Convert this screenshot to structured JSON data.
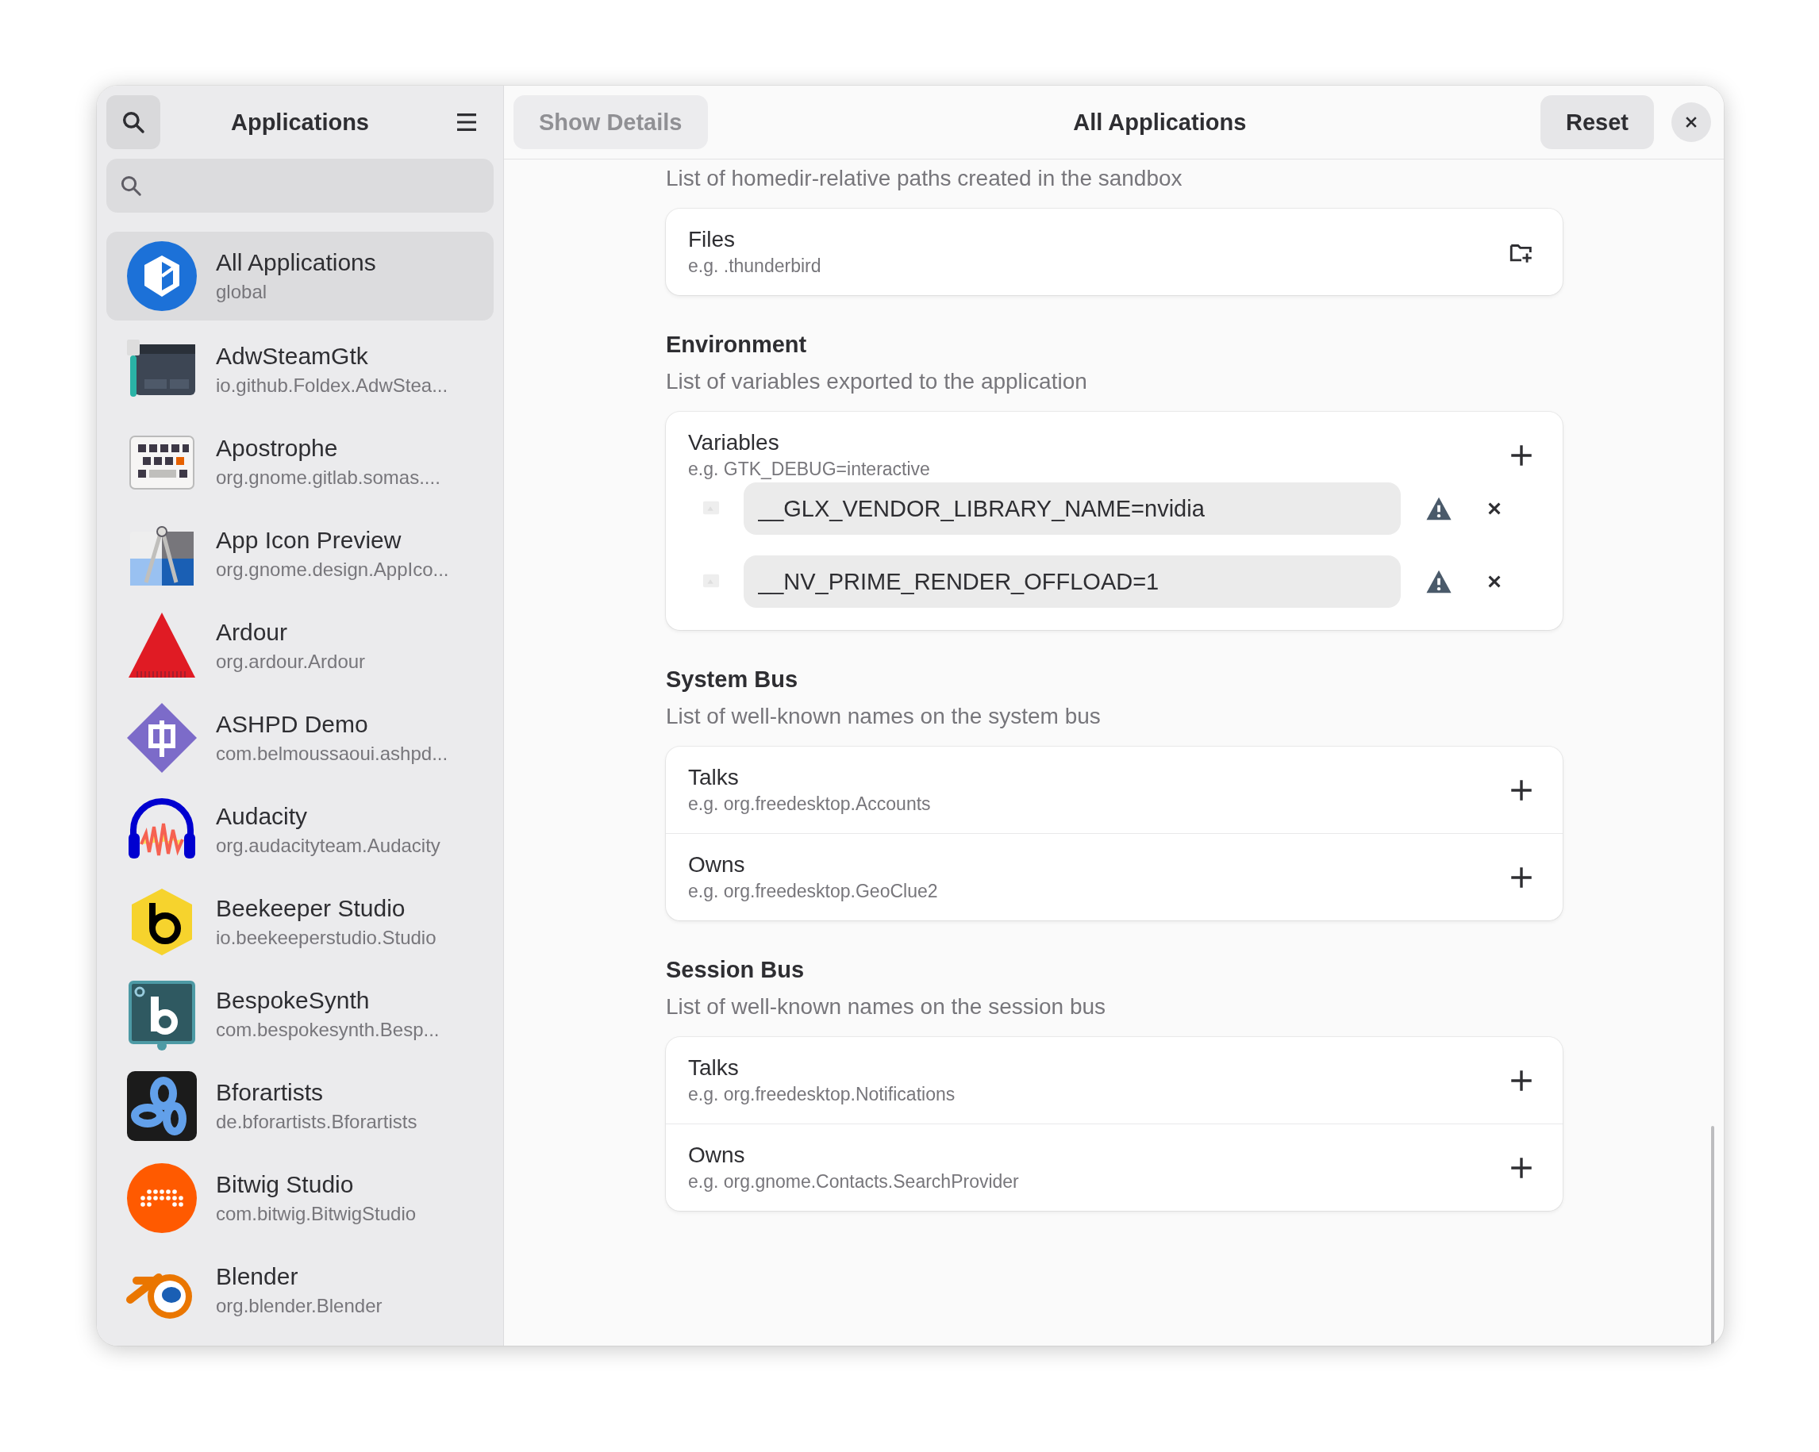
{
  "sidebar": {
    "title": "Applications",
    "items": [
      {
        "name": "All Applications",
        "id": "global",
        "selected": true
      },
      {
        "name": "AdwSteamGtk",
        "id": "io.github.Foldex.AdwStea...",
        "selected": false
      },
      {
        "name": "Apostrophe",
        "id": "org.gnome.gitlab.somas....",
        "selected": false
      },
      {
        "name": "App Icon Preview",
        "id": "org.gnome.design.AppIco...",
        "selected": false
      },
      {
        "name": "Ardour",
        "id": "org.ardour.Ardour",
        "selected": false
      },
      {
        "name": "ASHPD Demo",
        "id": "com.belmoussaoui.ashpd...",
        "selected": false
      },
      {
        "name": "Audacity",
        "id": "org.audacityteam.Audacity",
        "selected": false
      },
      {
        "name": "Beekeeper Studio",
        "id": "io.beekeeperstudio.Studio",
        "selected": false
      },
      {
        "name": "BespokeSynth",
        "id": "com.bespokesynth.Besp...",
        "selected": false
      },
      {
        "name": "Bforartists",
        "id": "de.bforartists.Bforartists",
        "selected": false
      },
      {
        "name": "Bitwig Studio",
        "id": "com.bitwig.BitwigStudio",
        "selected": false
      },
      {
        "name": "Blender",
        "id": "org.blender.Blender",
        "selected": false
      }
    ]
  },
  "header": {
    "show_details": {
      "label": "Show Details",
      "disabled": true
    },
    "title": "All Applications",
    "reset": "Reset"
  },
  "sections": [
    {
      "description": "List of homedir-relative paths created in the sandbox",
      "rows": [
        {
          "kind": "folder",
          "title": "Files",
          "hint": "e.g. .thunderbird"
        }
      ]
    },
    {
      "heading": "Environment",
      "description": "List of variables exported to the application",
      "rows": [
        {
          "kind": "add",
          "title": "Variables",
          "hint": "e.g. GTK_DEBUG=interactive",
          "entries": [
            {
              "value": "__GLX_VENDOR_LIBRARY_NAME=nvidia",
              "warning": true
            },
            {
              "value": "__NV_PRIME_RENDER_OFFLOAD=1",
              "warning": true
            }
          ]
        }
      ]
    },
    {
      "heading": "System Bus",
      "description": "List of well-known names on the system bus",
      "rows": [
        {
          "kind": "add",
          "title": "Talks",
          "hint": "e.g. org.freedesktop.Accounts"
        },
        {
          "kind": "add",
          "title": "Owns",
          "hint": "e.g. org.freedesktop.GeoClue2"
        }
      ]
    },
    {
      "heading": "Session Bus",
      "description": "List of well-known names on the session bus",
      "rows": [
        {
          "kind": "add",
          "title": "Talks",
          "hint": "e.g. org.freedesktop.Notifications"
        },
        {
          "kind": "add",
          "title": "Owns",
          "hint": "e.g. org.gnome.Contacts.SearchProvider"
        }
      ]
    }
  ]
}
